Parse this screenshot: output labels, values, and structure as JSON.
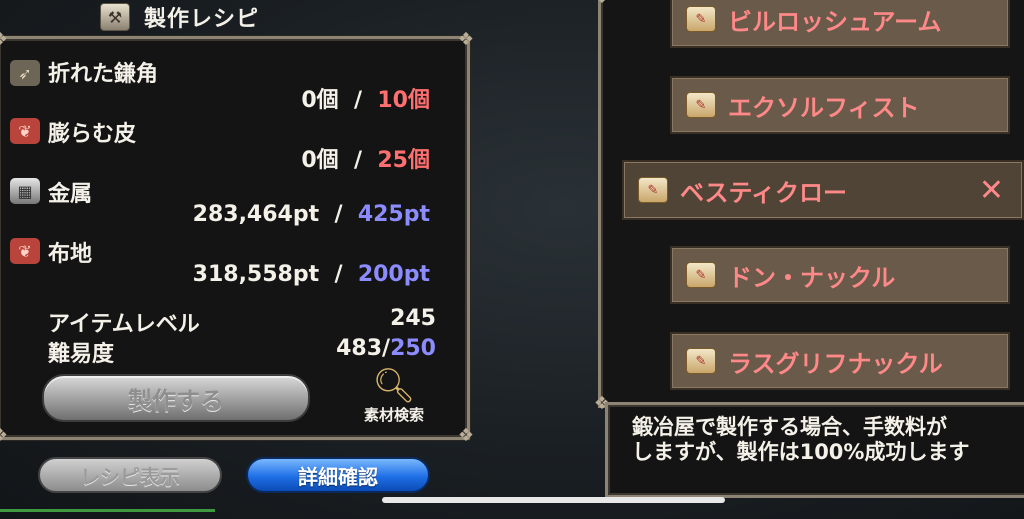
{
  "recipe_panel": {
    "title": "製作レシピ",
    "materials": [
      {
        "name": "折れた鎌角",
        "icon": "horn-icon",
        "have": "0個",
        "sep": "/",
        "need": "10個",
        "need_color": "red"
      },
      {
        "name": "膨らむ皮",
        "icon": "leather-icon",
        "have": "0個",
        "sep": "/",
        "need": "25個",
        "need_color": "red"
      },
      {
        "name": "金属",
        "icon": "metal-icon",
        "have": "283,464pt",
        "sep": "/",
        "need": "425pt",
        "need_color": "blue"
      },
      {
        "name": "布地",
        "icon": "cloth-icon",
        "have": "318,558pt",
        "sep": "/",
        "need": "200pt",
        "need_color": "blue"
      }
    ],
    "item_level_label": "アイテムレベル",
    "item_level_value": "245",
    "difficulty_label": "難易度",
    "difficulty_value": "483/",
    "difficulty_max": "250",
    "craft_button": "製作する",
    "search_label": "素材検索"
  },
  "tabs": {
    "recipe_view": "レシピ表示",
    "detail_check": "詳細確認"
  },
  "recipe_list": [
    {
      "label": "ビルロッシュアーム",
      "selected": false
    },
    {
      "label": "エクソルフィスト",
      "selected": false
    },
    {
      "label": "ベスティクロー",
      "selected": true
    },
    {
      "label": "ドン・ナックル",
      "selected": false
    },
    {
      "label": "ラスグリフナックル",
      "selected": false
    }
  ],
  "close_symbol": "✕",
  "description": {
    "line1": "鍛冶屋で製作する場合、手数料が",
    "line2": "しますが、製作は100%成功します"
  },
  "colors": {
    "red_value": "#ff6f6f",
    "blue_value": "#8c8cff",
    "recipe_item_text": "#ff8888",
    "detail_button": "#1f6fe6"
  }
}
